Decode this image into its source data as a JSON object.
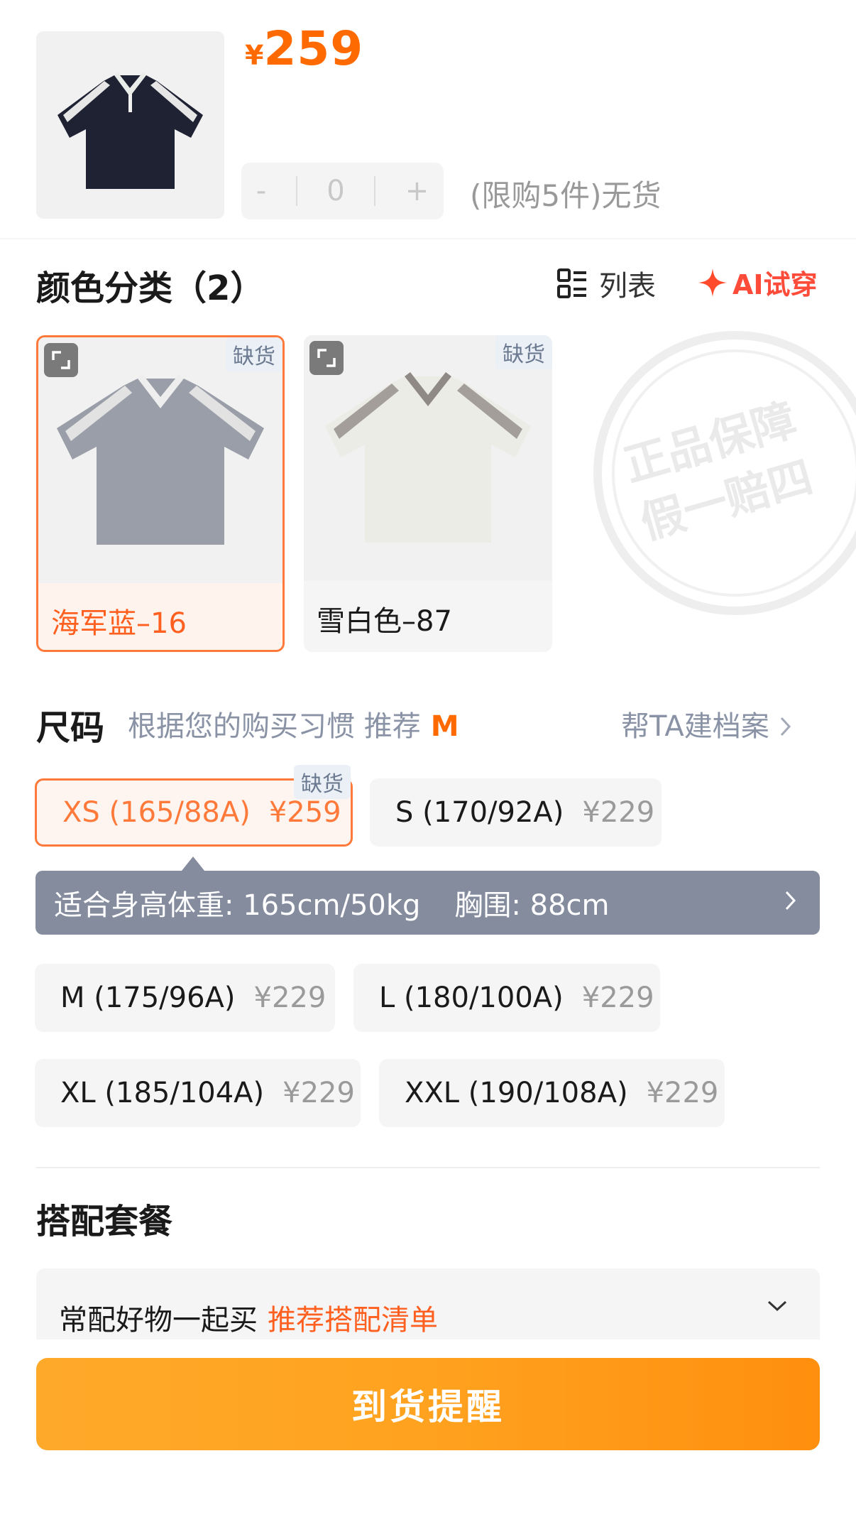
{
  "product": {
    "currency": "¥",
    "price": "259",
    "quantity_decrement": "-",
    "quantity_value": "0",
    "quantity_increment": "+",
    "limit_text": "(限购5件)无货"
  },
  "color_section": {
    "title": "颜色分类（2）",
    "list_label": "列表",
    "ai_try_label": "AI试穿",
    "options": [
      {
        "label": "海军蓝–16",
        "stock_tag": "缺货",
        "selected": true
      },
      {
        "label": "雪白色–87",
        "stock_tag": "缺货",
        "selected": false
      }
    ],
    "guarantee_seal": [
      "正品保障",
      "假一赔四"
    ]
  },
  "size_section": {
    "title": "尺码",
    "recommend_text": "根据您的购买习惯 推荐",
    "recommend_size": "M",
    "profile_link": "帮TA建档案",
    "options": [
      {
        "size": "XS (165/88A)",
        "price": "¥259",
        "stock_tag": "缺货",
        "selected": true
      },
      {
        "size": "S (170/92A)",
        "price": "¥229",
        "selected": false
      },
      {
        "size": "M (175/96A)",
        "price": "¥229",
        "selected": false
      },
      {
        "size": "L (180/100A)",
        "price": "¥229",
        "selected": false
      },
      {
        "size": "XL (185/104A)",
        "price": "¥229",
        "selected": false
      },
      {
        "size": "XXL (190/108A)",
        "price": "¥229",
        "selected": false
      }
    ],
    "fit_info": {
      "height_weight": "适合身高体重: 165cm/50kg",
      "chest": "胸围: 88cm"
    }
  },
  "combo_section": {
    "title": "搭配套餐",
    "text": "常配好物一起买",
    "link": "推荐搭配清单"
  },
  "cta": {
    "label": "到货提醒"
  },
  "colors": {
    "accent_orange": "#ff6a00",
    "selected_border": "#ff7a3a",
    "fit_bar": "#848c9e",
    "cta_start": "#ffa92a",
    "cta_end": "#ff8f0e"
  }
}
